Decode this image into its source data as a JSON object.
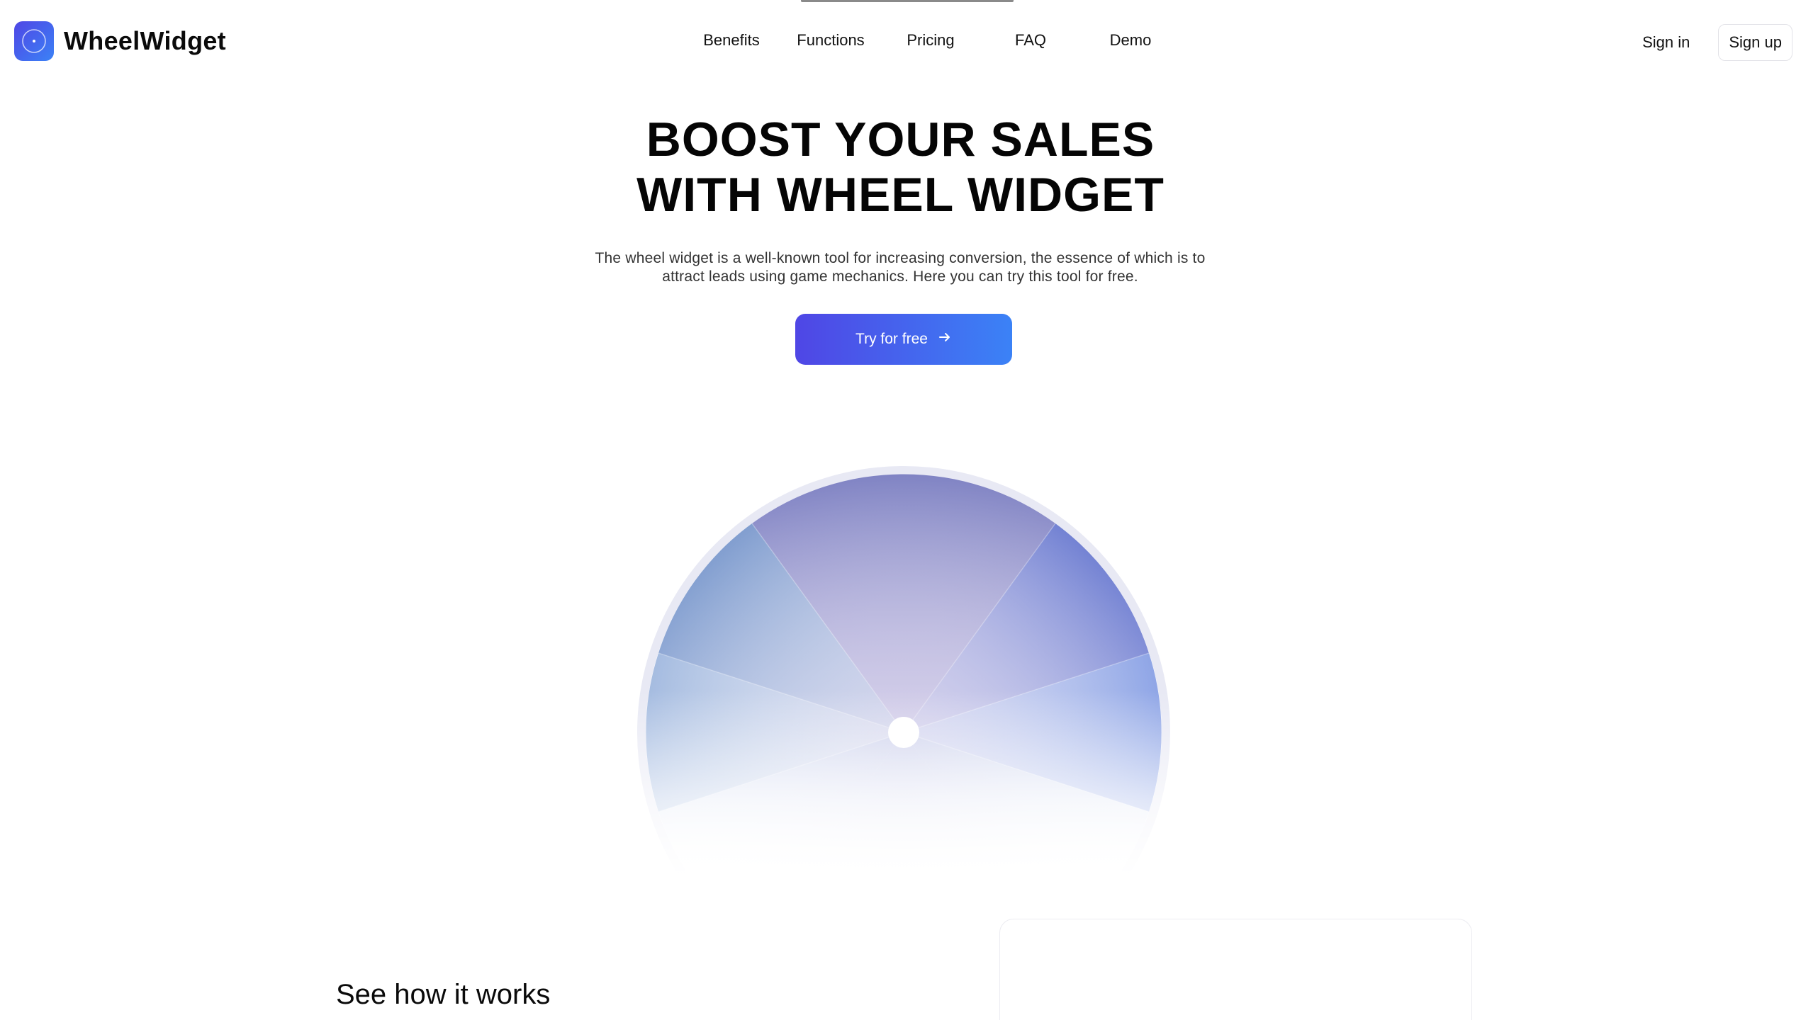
{
  "brand": {
    "name": "WheelWidget",
    "icon": "wheel-logo-icon"
  },
  "nav": {
    "items": [
      {
        "label": "Benefits"
      },
      {
        "label": "Functions"
      },
      {
        "label": "Pricing"
      },
      {
        "label": "FAQ"
      },
      {
        "label": "Demo"
      }
    ]
  },
  "auth": {
    "sign_in": "Sign in",
    "sign_up": "Sign up"
  },
  "hero": {
    "title_line1": "BOOST YOUR SALES",
    "title_line2": "WITH WHEEL WIDGET",
    "description": "The wheel widget is a well-known tool for increasing conversion, the essence of which is to attract leads using game mechanics. Here you can try this tool for free.",
    "cta_label": "Try for free",
    "cta_icon": "arrow-right-icon"
  },
  "wheel": {
    "segments": 8,
    "colors": {
      "top": "#7d83c4",
      "accent": "#4f46e5",
      "blue": "#3b82f6"
    }
  },
  "section": {
    "title": "See how it works"
  },
  "colors": {
    "gradient_start": "#4f46e5",
    "gradient_end": "#3b82f6",
    "text": "#0a0a0a"
  }
}
